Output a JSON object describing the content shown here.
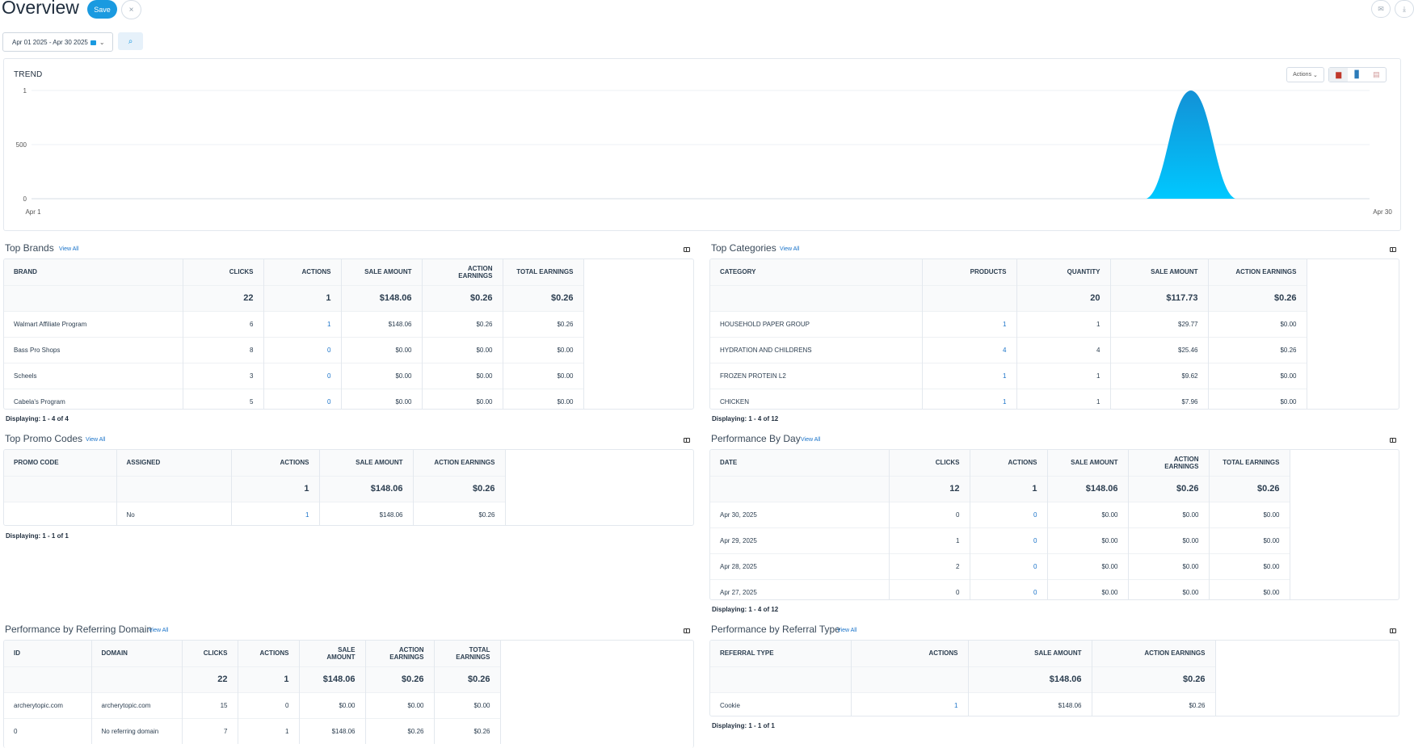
{
  "header": {
    "title": "Overview",
    "save_label": "Save",
    "close_glyph": "×",
    "mail_icon": "mail-icon",
    "download_icon": "download-icon"
  },
  "filter": {
    "date_range": "Apr 01 2025 - Apr 30 2025",
    "search_icon": "search-icon"
  },
  "trend": {
    "title": "TREND",
    "actions_label": "Actions",
    "chart_data": {
      "type": "area",
      "y_ticks": [
        "1",
        "500",
        "0"
      ],
      "x_labels": [
        "Apr 1",
        "Apr 30"
      ],
      "x": [
        "Apr 1",
        "Apr 27",
        "Apr 28",
        "Apr 29",
        "Apr 30"
      ],
      "values": [
        0,
        0,
        0,
        1,
        0
      ],
      "grid": true,
      "accent": "#1aa3e8"
    }
  },
  "view_all": "View All",
  "top_brands": {
    "title": "Top Brands",
    "columns": [
      "BRAND",
      "CLICKS",
      "ACTIONS",
      "SALE AMOUNT",
      "ACTION EARNINGS",
      "TOTAL EARNINGS"
    ],
    "totals": [
      "",
      "22",
      "1",
      "$148.06",
      "$0.26",
      "$0.26"
    ],
    "rows": [
      [
        "Walmart Affiliate Program",
        "6",
        "1",
        "$148.06",
        "$0.26",
        "$0.26"
      ],
      [
        "Bass Pro Shops",
        "8",
        "0",
        "$0.00",
        "$0.00",
        "$0.00"
      ],
      [
        "Scheels",
        "3",
        "0",
        "$0.00",
        "$0.00",
        "$0.00"
      ],
      [
        "Cabela's Program",
        "5",
        "0",
        "$0.00",
        "$0.00",
        "$0.00"
      ]
    ],
    "displaying": "Displaying: 1 - 4 of 4"
  },
  "top_categories": {
    "title": "Top Categories",
    "columns": [
      "CATEGORY",
      "PRODUCTS",
      "QUANTITY",
      "SALE AMOUNT",
      "ACTION EARNINGS"
    ],
    "totals": [
      "",
      "",
      "20",
      "$117.73",
      "$0.26"
    ],
    "rows": [
      [
        "HOUSEHOLD PAPER GROUP",
        "1",
        "1",
        "$29.77",
        "$0.00"
      ],
      [
        "HYDRATION AND CHILDRENS",
        "4",
        "4",
        "$25.46",
        "$0.26"
      ],
      [
        "FROZEN PROTEIN L2",
        "1",
        "1",
        "$9.62",
        "$0.00"
      ],
      [
        "CHICKEN",
        "1",
        "1",
        "$7.96",
        "$0.00"
      ]
    ],
    "displaying": "Displaying: 1 - 4 of 12"
  },
  "top_promo": {
    "title": "Top Promo Codes",
    "columns": [
      "PROMO CODE",
      "ASSIGNED",
      "ACTIONS",
      "SALE AMOUNT",
      "ACTION EARNINGS"
    ],
    "totals": [
      "",
      "",
      "1",
      "$148.06",
      "$0.26"
    ],
    "rows": [
      [
        "",
        "No",
        "1",
        "$148.06",
        "$0.26"
      ]
    ],
    "displaying": "Displaying: 1 - 1 of 1"
  },
  "perf_day": {
    "title": "Performance By Day",
    "columns": [
      "DATE",
      "CLICKS",
      "ACTIONS",
      "SALE AMOUNT",
      "ACTION EARNINGS",
      "TOTAL EARNINGS"
    ],
    "totals": [
      "",
      "12",
      "1",
      "$148.06",
      "$0.26",
      "$0.26"
    ],
    "rows": [
      [
        "Apr 30, 2025",
        "0",
        "0",
        "$0.00",
        "$0.00",
        "$0.00"
      ],
      [
        "Apr 29, 2025",
        "1",
        "0",
        "$0.00",
        "$0.00",
        "$0.00"
      ],
      [
        "Apr 28, 2025",
        "2",
        "0",
        "$0.00",
        "$0.00",
        "$0.00"
      ],
      [
        "Apr 27, 2025",
        "0",
        "0",
        "$0.00",
        "$0.00",
        "$0.00"
      ]
    ],
    "displaying": "Displaying: 1 - 4 of 12"
  },
  "perf_domain": {
    "title": "Performance by Referring Domain",
    "columns": [
      "ID",
      "DOMAIN",
      "CLICKS",
      "ACTIONS",
      "SALE AMOUNT",
      "ACTION EARNINGS",
      "TOTAL EARNINGS"
    ],
    "totals": [
      "",
      "",
      "22",
      "1",
      "$148.06",
      "$0.26",
      "$0.26"
    ],
    "rows": [
      [
        "archerytopic.com",
        "archerytopic.com",
        "15",
        "0",
        "$0.00",
        "$0.00",
        "$0.00"
      ],
      [
        "0",
        "No referring domain",
        "7",
        "1",
        "$148.06",
        "$0.26",
        "$0.26"
      ]
    ]
  },
  "perf_ref": {
    "title": "Performance by Referral Type",
    "columns": [
      "REFERRAL TYPE",
      "ACTIONS",
      "SALE AMOUNT",
      "ACTION EARNINGS"
    ],
    "totals": [
      "",
      "",
      "$148.06",
      "$0.26"
    ],
    "rows": [
      [
        "Cookie",
        "1",
        "$148.06",
        "$0.26"
      ]
    ],
    "displaying": "Displaying: 1 - 1 of 1"
  }
}
